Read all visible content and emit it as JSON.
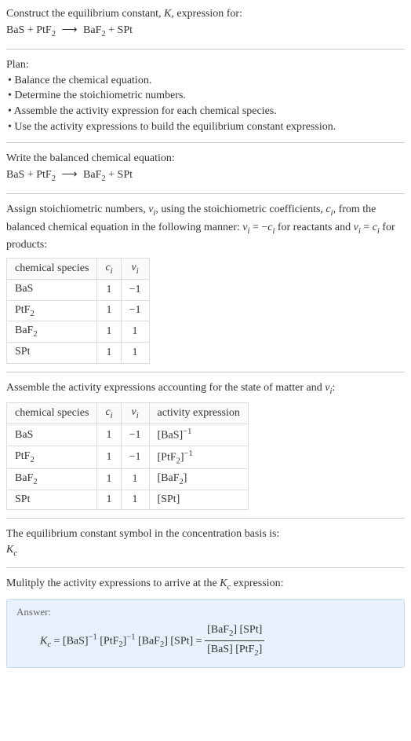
{
  "intro": {
    "line1_a": "Construct the equilibrium constant, ",
    "line1_b": "K",
    "line1_c": ", expression for:",
    "eq_lhs1": "BaS",
    "eq_plus": " + ",
    "eq_lhs2": "PtF",
    "eq_lhs2_sub": "2",
    "eq_arrow": "⟶",
    "eq_rhs1": "BaF",
    "eq_rhs1_sub": "2",
    "eq_rhs2": "SPt"
  },
  "plan": {
    "header": "Plan:",
    "b1": "• Balance the chemical equation.",
    "b2": "• Determine the stoichiometric numbers.",
    "b3": "• Assemble the activity expression for each chemical species.",
    "b4": "• Use the activity expressions to build the equilibrium constant expression."
  },
  "balanced": {
    "text": "Write the balanced chemical equation:"
  },
  "stoich_text": {
    "a": "Assign stoichiometric numbers, ",
    "nu": "ν",
    "i": "i",
    "b": ", using the stoichiometric coefficients, ",
    "c": "c",
    "d": ", from the balanced chemical equation in the following manner: ",
    "eq1a": " = −",
    "eq1b": " for reactants and ",
    "eq2a": " = ",
    "eq2b": " for products:"
  },
  "table1": {
    "h1": "chemical species",
    "h2": "c",
    "h2_sub": "i",
    "h3": "ν",
    "h3_sub": "i",
    "rows": [
      {
        "sp": "BaS",
        "sp_sub": "",
        "c": "1",
        "v": "−1"
      },
      {
        "sp": "PtF",
        "sp_sub": "2",
        "c": "1",
        "v": "−1"
      },
      {
        "sp": "BaF",
        "sp_sub": "2",
        "c": "1",
        "v": "1"
      },
      {
        "sp": "SPt",
        "sp_sub": "",
        "c": "1",
        "v": "1"
      }
    ]
  },
  "assemble_text": {
    "a": "Assemble the activity expressions accounting for the state of matter and ",
    "b": ":"
  },
  "table2": {
    "h1": "chemical species",
    "h2": "c",
    "h2_sub": "i",
    "h3": "ν",
    "h3_sub": "i",
    "h4": "activity expression",
    "rows": [
      {
        "sp": "BaS",
        "sp_sub": "",
        "c": "1",
        "v": "−1",
        "act_a": "[BaS]",
        "act_sup": "−1"
      },
      {
        "sp": "PtF",
        "sp_sub": "2",
        "c": "1",
        "v": "−1",
        "act_a": "[PtF",
        "act_sub": "2",
        "act_b": "]",
        "act_sup": "−1"
      },
      {
        "sp": "BaF",
        "sp_sub": "2",
        "c": "1",
        "v": "1",
        "act_a": "[BaF",
        "act_sub": "2",
        "act_b": "]",
        "act_sup": ""
      },
      {
        "sp": "SPt",
        "sp_sub": "",
        "c": "1",
        "v": "1",
        "act_a": "[SPt]",
        "act_sup": ""
      }
    ]
  },
  "symbol_text": "The equilibrium constant symbol in the concentration basis is:",
  "Kc_K": "K",
  "Kc_c": "c",
  "multiply_text_a": "Mulitply the activity expressions to arrive at the ",
  "multiply_text_b": " expression:",
  "answer": {
    "label": "Answer:",
    "eq_part1": " = [BaS]",
    "eq_sup1": "−1",
    "eq_part2": " [PtF",
    "eq_sub2": "2",
    "eq_part3": "]",
    "eq_sup3": "−1",
    "eq_part4": " [BaF",
    "eq_sub4": "2",
    "eq_part5": "] [SPt] = ",
    "num_a": "[BaF",
    "num_sub": "2",
    "num_b": "] [SPt]",
    "den_a": "[BaS] [PtF",
    "den_sub": "2",
    "den_b": "]"
  }
}
